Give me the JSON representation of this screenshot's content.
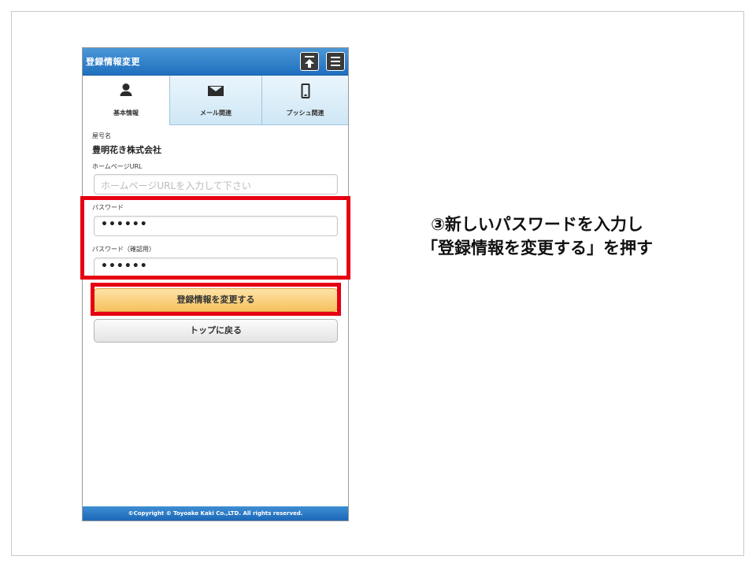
{
  "header": {
    "title": "登録情報変更",
    "top_icon": "arrow-up-to-top-icon",
    "menu_icon": "hamburger-menu-icon"
  },
  "tabs": [
    {
      "label": "基本情報",
      "icon": "user-icon",
      "active": true
    },
    {
      "label": "メール関連",
      "icon": "mail-icon",
      "active": false
    },
    {
      "label": "プッシュ関連",
      "icon": "smartphone-icon",
      "active": false
    }
  ],
  "form": {
    "shop_name_label": "屋号名",
    "shop_name_value": "豊明花き株式会社",
    "homepage_label": "ホームページURL",
    "homepage_placeholder": "ホームページURLを入力して下さい",
    "password_label": "パスワード",
    "password_value": "••••••",
    "password_confirm_label": "パスワード（確認用）",
    "password_confirm_value": "••••••"
  },
  "buttons": {
    "submit_label": "登録情報を変更する",
    "back_label": "トップに戻る"
  },
  "footer": {
    "copyright": "©Copyright © Toyoake Kaki Co.,LTD. All rights reserved."
  },
  "instruction": {
    "line1": "③新しいパスワードを入力し",
    "line2": "「登録情報を変更する」を押す"
  },
  "colors": {
    "header_blue": "#1f6fbf",
    "highlight_red": "#e60012",
    "button_orange": "#f7c15e"
  }
}
